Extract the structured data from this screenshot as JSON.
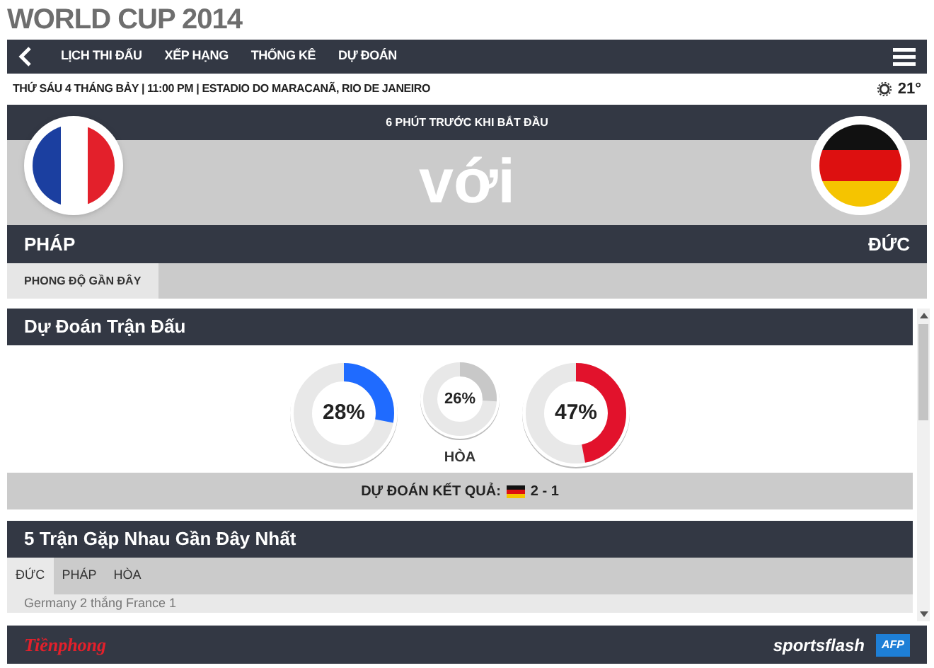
{
  "page_title": "WORLD CUP 2014",
  "nav": {
    "items": [
      {
        "label": "LỊCH THI ĐẤU"
      },
      {
        "label": "XẾP HẠNG"
      },
      {
        "label": "THỐNG KÊ"
      },
      {
        "label": "DỰ ĐOÁN"
      }
    ]
  },
  "match_info": {
    "details": "THỨ SÁU 4 THÁNG BẢY | 11:00 PM | ESTADIO DO MARACANÃ, RIO DE JANEIRO",
    "temperature": "21°"
  },
  "match": {
    "countdown": "6 PHÚT TRƯỚC KHI BẮT ĐẦU",
    "versus": "với",
    "home_team": "PHÁP",
    "away_team": "ĐỨC"
  },
  "form_tab": {
    "label": "PHONG ĐỘ GẦN ĐÂY"
  },
  "prediction": {
    "heading": "Dự Đoán Trận Đấu",
    "outcomes": [
      {
        "kind": "team",
        "value": "28%",
        "level": 0.28,
        "color": "#1f6bff"
      },
      {
        "kind": "draw",
        "value": "26%",
        "level": 0.26,
        "color": "#c8c8c8",
        "caption": "HÒA"
      },
      {
        "kind": "team",
        "value": "47%",
        "level": 0.47,
        "color": "#e2122c"
      }
    ],
    "result_label": "DỰ ĐOÁN KẾT QUẢ:",
    "result_score": "2 - 1"
  },
  "head_to_head": {
    "heading": "5 Trận Gặp Nhau Gần Đây Nhất",
    "tabs": [
      {
        "label": "ĐỨC",
        "selected": true
      },
      {
        "label": "PHÁP",
        "selected": false
      },
      {
        "label": "HÒA",
        "selected": false
      }
    ],
    "rows": [
      "Germany 2 thắng France 1"
    ]
  },
  "footer": {
    "left_logo": "Tiềnphong",
    "right_logo": "sportsflash",
    "badge": "AFP"
  }
}
